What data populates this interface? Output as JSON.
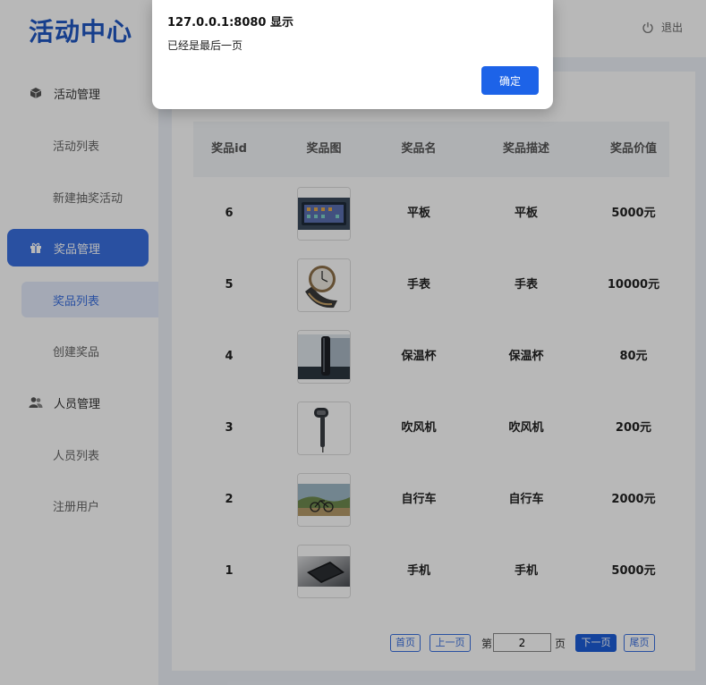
{
  "header": {
    "logo": "活动中心",
    "logout_label": "退出"
  },
  "sidebar": {
    "groups": [
      {
        "label": "活动管理",
        "icon": "cube-icon"
      },
      {
        "label": "奖品管理",
        "icon": "gift-icon"
      },
      {
        "label": "人员管理",
        "icon": "users-icon"
      }
    ],
    "subs": [
      {
        "label": "活动列表"
      },
      {
        "label": "新建抽奖活动"
      },
      {
        "label": "奖品列表"
      },
      {
        "label": "创建奖品"
      },
      {
        "label": "人员列表"
      },
      {
        "label": "注册用户"
      }
    ]
  },
  "table": {
    "headers": [
      "奖品id",
      "奖品图",
      "奖品名",
      "奖品描述",
      "奖品价值"
    ],
    "rows": [
      {
        "id": "6",
        "name": "平板",
        "desc": "平板",
        "value": "5000元",
        "image": "tablet"
      },
      {
        "id": "5",
        "name": "手表",
        "desc": "手表",
        "value": "10000元",
        "image": "watch"
      },
      {
        "id": "4",
        "name": "保温杯",
        "desc": "保温杯",
        "value": "80元",
        "image": "thermos"
      },
      {
        "id": "3",
        "name": "吹风机",
        "desc": "吹风机",
        "value": "200元",
        "image": "hairdryer"
      },
      {
        "id": "2",
        "name": "自行车",
        "desc": "自行车",
        "value": "2000元",
        "image": "bicycle"
      },
      {
        "id": "1",
        "name": "手机",
        "desc": "手机",
        "value": "5000元",
        "image": "phone"
      }
    ]
  },
  "pagination": {
    "first": "首页",
    "prev": "上一页",
    "page_prefix": "第",
    "page_value": "2",
    "page_suffix": "页",
    "next": "下一页",
    "last": "尾页"
  },
  "dialog": {
    "title": "127.0.0.1:8080 显示",
    "message": "已经是最后一页",
    "ok_label": "确定"
  },
  "colors": {
    "brand": "#1f57c3",
    "accent": "#3a6fe0",
    "primary_button": "#1d63e8"
  }
}
